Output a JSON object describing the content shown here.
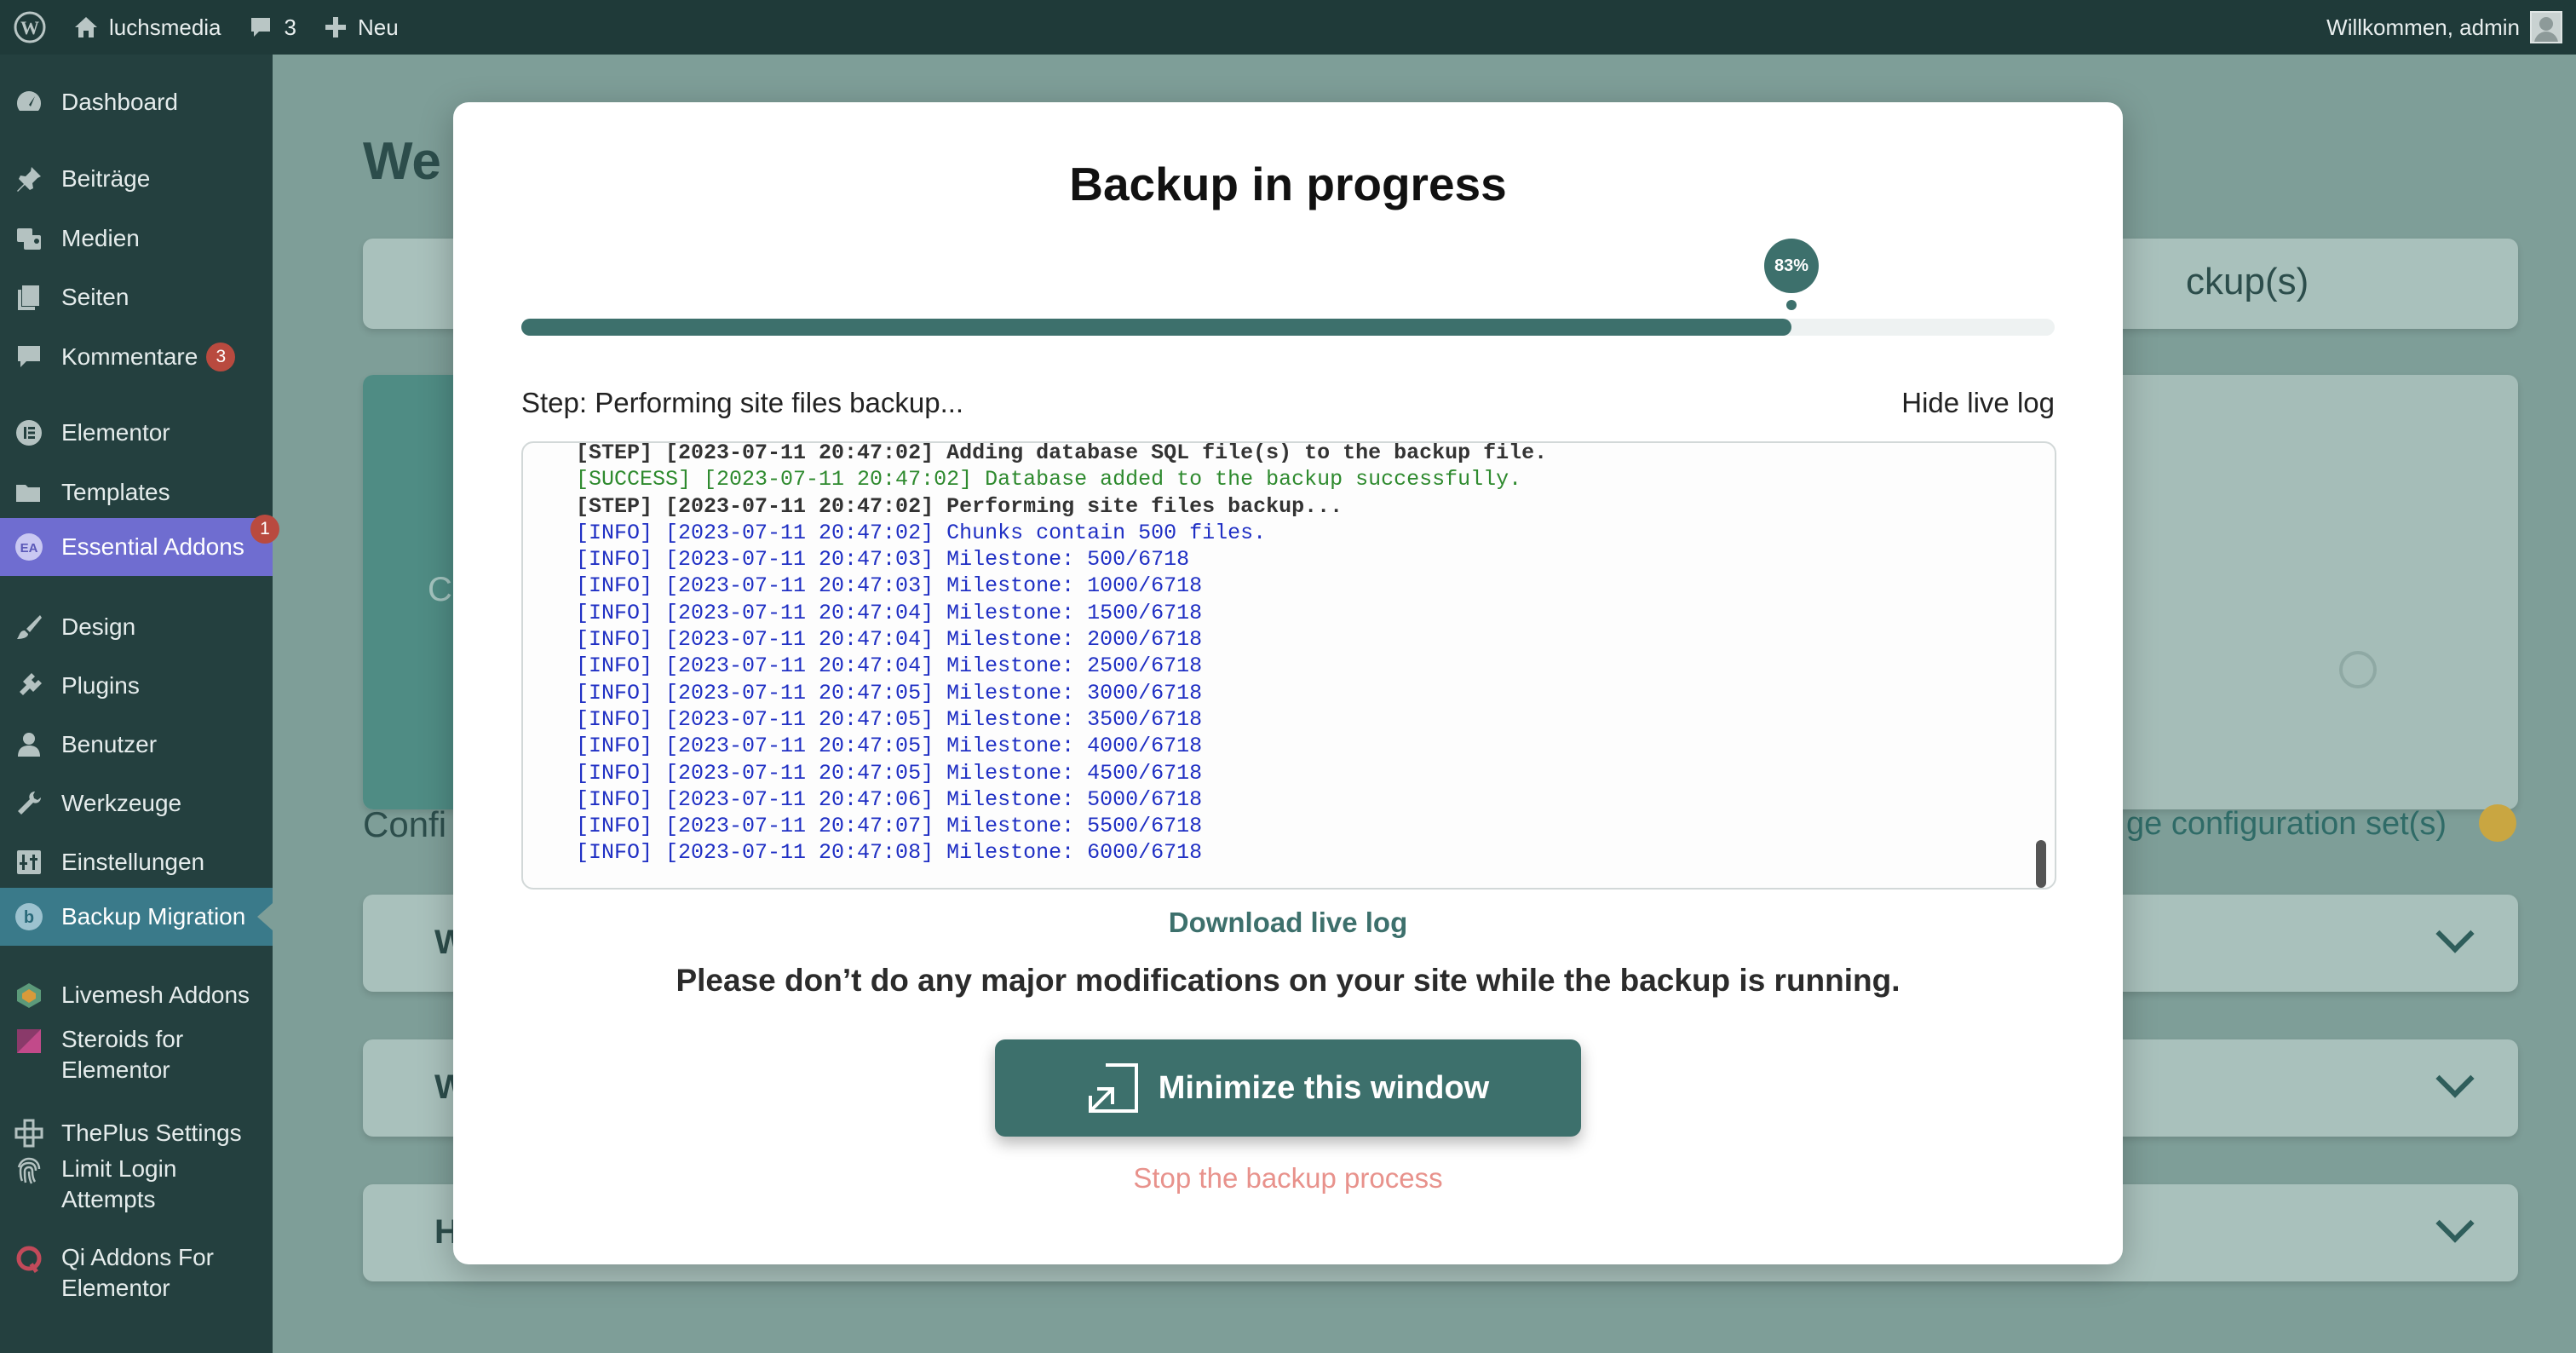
{
  "adminbar": {
    "site_name": "luchsmedia",
    "comments_count": "3",
    "new_label": "Neu",
    "welcome": "Willkommen, admin"
  },
  "sidebar": {
    "items": [
      {
        "label": "Dashboard",
        "icon": "dashboard-icon"
      },
      {
        "label": "Beiträge",
        "icon": "pin-icon"
      },
      {
        "label": "Medien",
        "icon": "media-icon"
      },
      {
        "label": "Seiten",
        "icon": "pages-icon"
      },
      {
        "label": "Kommentare",
        "icon": "comments-icon",
        "badge": "3"
      },
      {
        "label": "Elementor",
        "icon": "elementor-icon"
      },
      {
        "label": "Templates",
        "icon": "folder-icon"
      },
      {
        "label": "Essential Addons",
        "icon": "ea-icon",
        "badge": "1"
      },
      {
        "label": "Design",
        "icon": "brush-icon"
      },
      {
        "label": "Plugins",
        "icon": "plugin-icon"
      },
      {
        "label": "Benutzer",
        "icon": "user-icon"
      },
      {
        "label": "Werkzeuge",
        "icon": "wrench-icon"
      },
      {
        "label": "Einstellungen",
        "icon": "settings-icon"
      },
      {
        "label": "Backup Migration",
        "icon": "backup-icon"
      },
      {
        "label": "Livemesh Addons",
        "icon": "livemesh-icon"
      },
      {
        "label": "Steroids for Elementor",
        "icon": "steroids-icon"
      },
      {
        "label": "ThePlus Settings",
        "icon": "theplus-icon"
      },
      {
        "label": "Limit Login Attempts",
        "icon": "fingerprint-icon"
      },
      {
        "label": "Qi Addons For Elementor",
        "icon": "qi-icon"
      }
    ]
  },
  "background": {
    "heading_fragment": "We",
    "tab_fragment": "ckup(s)",
    "card_fragment": "C",
    "config_fragment": "Confi",
    "manage_fragment": "ge configuration set(s)",
    "row1_fragment": "W",
    "row2_fragment": "W",
    "row3_fragment": "H"
  },
  "modal": {
    "title": "Backup in progress",
    "progress_percent": 83,
    "progress_label": "83%",
    "step_text": "Step: Performing site files backup...",
    "hide_log_label": "Hide live log",
    "log_lines": [
      {
        "type": "step",
        "text": "[STEP] [2023-07-11 20:47:02] Adding database SQL file(s) to the backup file."
      },
      {
        "type": "success",
        "text": "[SUCCESS] [2023-07-11 20:47:02] Database added to the backup successfully."
      },
      {
        "type": "step",
        "text": "[STEP] [2023-07-11 20:47:02] Performing site files backup..."
      },
      {
        "type": "info",
        "text": "[INFO] [2023-07-11 20:47:02] Chunks contain 500 files."
      },
      {
        "type": "info",
        "text": "[INFO] [2023-07-11 20:47:03] Milestone: 500/6718"
      },
      {
        "type": "info",
        "text": "[INFO] [2023-07-11 20:47:03] Milestone: 1000/6718"
      },
      {
        "type": "info",
        "text": "[INFO] [2023-07-11 20:47:04] Milestone: 1500/6718"
      },
      {
        "type": "info",
        "text": "[INFO] [2023-07-11 20:47:04] Milestone: 2000/6718"
      },
      {
        "type": "info",
        "text": "[INFO] [2023-07-11 20:47:04] Milestone: 2500/6718"
      },
      {
        "type": "info",
        "text": "[INFO] [2023-07-11 20:47:05] Milestone: 3000/6718"
      },
      {
        "type": "info",
        "text": "[INFO] [2023-07-11 20:47:05] Milestone: 3500/6718"
      },
      {
        "type": "info",
        "text": "[INFO] [2023-07-11 20:47:05] Milestone: 4000/6718"
      },
      {
        "type": "info",
        "text": "[INFO] [2023-07-11 20:47:05] Milestone: 4500/6718"
      },
      {
        "type": "info",
        "text": "[INFO] [2023-07-11 20:47:06] Milestone: 5000/6718"
      },
      {
        "type": "info",
        "text": "[INFO] [2023-07-11 20:47:07] Milestone: 5500/6718"
      },
      {
        "type": "info",
        "text": "[INFO] [2023-07-11 20:47:08] Milestone: 6000/6718"
      }
    ],
    "download_log_label": "Download live log",
    "warning": "Please don’t do any major modifications on your site while the backup is running.",
    "minimize_label": "Minimize this window",
    "stop_label": "Stop the backup process"
  },
  "colors": {
    "accent": "#3d706c",
    "stop": "#e8928c",
    "log_info": "#1f2fc4",
    "log_success": "#2e8a2e"
  }
}
